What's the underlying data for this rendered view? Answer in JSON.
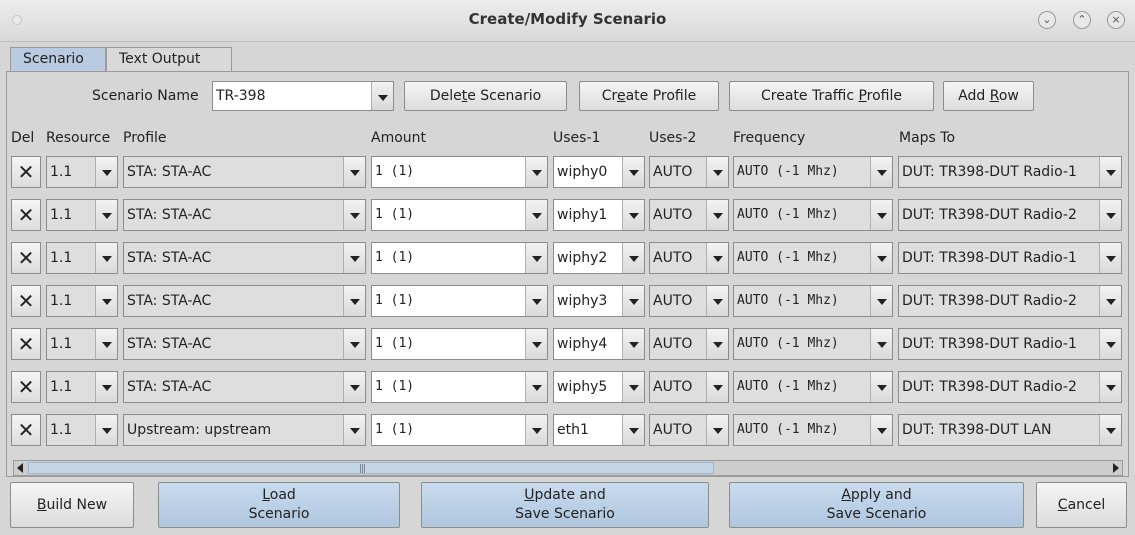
{
  "window": {
    "title": "Create/Modify Scenario",
    "controls": [
      "minimize-icon",
      "maximize-icon",
      "close-icon"
    ],
    "control_glyphs": [
      "⌄",
      "⌃",
      "×"
    ]
  },
  "tabs": [
    {
      "label": "Scenario",
      "active": true
    },
    {
      "label": "Text Output",
      "active": false
    }
  ],
  "toolbar": {
    "scenario_name_label": "Scenario Name",
    "scenario_name_value": "TR-398",
    "delete_scenario": {
      "pre": "Dele",
      "u": "t",
      "post": "e Scenario"
    },
    "create_profile": {
      "pre": "Cr",
      "u": "e",
      "post": "ate Profile"
    },
    "create_traffic_profile": {
      "pre": "Create Traffic ",
      "u": "P",
      "post": "rofile"
    },
    "add_row": {
      "pre": "Add ",
      "u": "R",
      "post": "ow"
    }
  },
  "table": {
    "columns": [
      "Del",
      "Resource",
      "Profile",
      "Amount",
      "Uses-1",
      "Uses-2",
      "Frequency",
      "Maps To"
    ],
    "del_glyph": "✕",
    "rows": [
      {
        "resource": "1.1",
        "profile": "STA: STA-AC",
        "amount": "1 (1)",
        "uses1": "wiphy0",
        "uses2": "AUTO",
        "frequency": "AUTO (-1 Mhz)",
        "maps_to": "DUT: TR398-DUT Radio-1"
      },
      {
        "resource": "1.1",
        "profile": "STA: STA-AC",
        "amount": "1 (1)",
        "uses1": "wiphy1",
        "uses2": "AUTO",
        "frequency": "AUTO (-1 Mhz)",
        "maps_to": "DUT: TR398-DUT Radio-2"
      },
      {
        "resource": "1.1",
        "profile": "STA: STA-AC",
        "amount": "1 (1)",
        "uses1": "wiphy2",
        "uses2": "AUTO",
        "frequency": "AUTO (-1 Mhz)",
        "maps_to": "DUT: TR398-DUT Radio-1"
      },
      {
        "resource": "1.1",
        "profile": "STA: STA-AC",
        "amount": "1 (1)",
        "uses1": "wiphy3",
        "uses2": "AUTO",
        "frequency": "AUTO (-1 Mhz)",
        "maps_to": "DUT: TR398-DUT Radio-2"
      },
      {
        "resource": "1.1",
        "profile": "STA: STA-AC",
        "amount": "1 (1)",
        "uses1": "wiphy4",
        "uses2": "AUTO",
        "frequency": "AUTO (-1 Mhz)",
        "maps_to": "DUT: TR398-DUT Radio-1"
      },
      {
        "resource": "1.1",
        "profile": "STA: STA-AC",
        "amount": "1 (1)",
        "uses1": "wiphy5",
        "uses2": "AUTO",
        "frequency": "AUTO (-1 Mhz)",
        "maps_to": "DUT: TR398-DUT Radio-2"
      },
      {
        "resource": "1.1",
        "profile": "Upstream: upstream",
        "amount": "1 (1)",
        "uses1": "eth1",
        "uses2": "AUTO",
        "frequency": "AUTO (-1 Mhz)",
        "maps_to": "DUT: TR398-DUT LAN"
      }
    ]
  },
  "scrollbar_grip": "|||",
  "bottom_buttons": {
    "build_new": {
      "u": "B",
      "post": "uild New"
    },
    "load": {
      "l1_u": "L",
      "l1_post": "oad",
      "l2": "Scenario"
    },
    "update": {
      "l1_u": "U",
      "l1_post": "pdate and",
      "l2": "Save Scenario"
    },
    "apply": {
      "l1_u": "A",
      "l1_post": "pply and",
      "l2": "Save Scenario"
    },
    "cancel": {
      "u": "C",
      "post": "ancel"
    }
  },
  "colors": {
    "active_tab": "#b8cbe0",
    "accent_button": "#bcd0e6",
    "background": "#d6d6d6"
  }
}
